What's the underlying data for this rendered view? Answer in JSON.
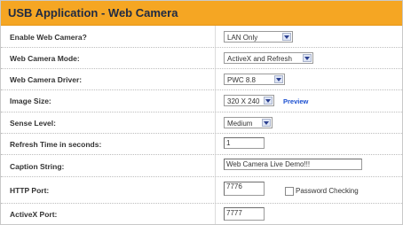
{
  "header": {
    "title": "USB Application - Web Camera"
  },
  "rows": [
    {
      "label": "Enable Web Camera?",
      "value": "LAN Only"
    },
    {
      "label": "Web Camera Mode:",
      "value": "ActiveX and Refresh"
    },
    {
      "label": "Web Camera Driver:",
      "value": "PWC 8.8"
    },
    {
      "label": "Image Size:",
      "value": "320 X 240",
      "link": "Preview"
    },
    {
      "label": "Sense Level:",
      "value": "Medium"
    },
    {
      "label": "Refresh Time in seconds:",
      "value": "1"
    },
    {
      "label": "Caption String:",
      "value": "Web Camera Live Demo!!!"
    },
    {
      "label": "HTTP Port:",
      "value": "7776",
      "checkbox_label": "Password Checking"
    },
    {
      "label": "ActiveX Port:",
      "value": "7777"
    }
  ],
  "colors": {
    "header_bg": "#f5a623",
    "header_text": "#1e2a44",
    "link": "#1b4fd0"
  }
}
